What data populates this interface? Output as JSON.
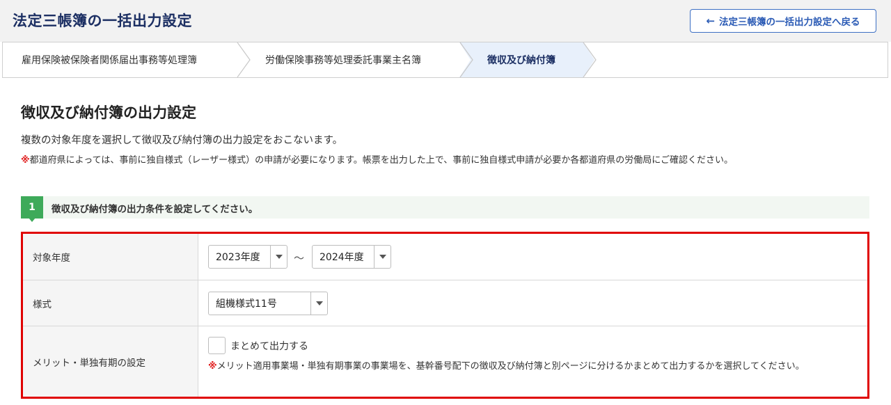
{
  "header": {
    "title": "法定三帳簿の一括出力設定",
    "back_button": "法定三帳簿の一括出力設定へ戻る",
    "back_icon": "arrow-left-icon"
  },
  "steps": [
    {
      "label": "雇用保険被保険者関係届出事務等処理簿",
      "active": false
    },
    {
      "label": "労働保険事務等処理委託事業主名簿",
      "active": false
    },
    {
      "label": "徴収及び納付簿",
      "active": true
    }
  ],
  "colors": {
    "title": "#1c2f63",
    "accent_blue": "#2b5bb5",
    "step_active_bg": "#e8f0fb",
    "step_green": "#3eaa5a",
    "highlight_border": "#e00000",
    "warning_mark": "#e02020"
  },
  "section": {
    "title": "徴収及び納付簿の出力設定",
    "description": "複数の対象年度を選択して徴収及び納付簿の出力設定をおこないます。",
    "note_mark": "※",
    "note": "都道府県によっては、事前に独自様式（レーザー様式）の申請が必要になります。帳票を出力した上で、事前に独自様式申請が必要か各都道府県の労働局にご確認ください。"
  },
  "step_banner": {
    "number": "1",
    "text": "徴収及び納付簿の出力条件を設定してください。"
  },
  "form": {
    "year": {
      "label": "対象年度",
      "from": "2023年度",
      "separator": "～",
      "to": "2024年度"
    },
    "format": {
      "label": "様式",
      "value": "組機様式11号"
    },
    "merit": {
      "label": "メリット・単独有期の設定",
      "checkbox_label": "まとめて出力する",
      "checked": false,
      "note_mark": "※",
      "note": "メリット適用事業場・単独有期事業の事業場を、基幹番号配下の徴収及び納付簿と別ページに分けるかまとめて出力するかを選択してください。"
    }
  }
}
